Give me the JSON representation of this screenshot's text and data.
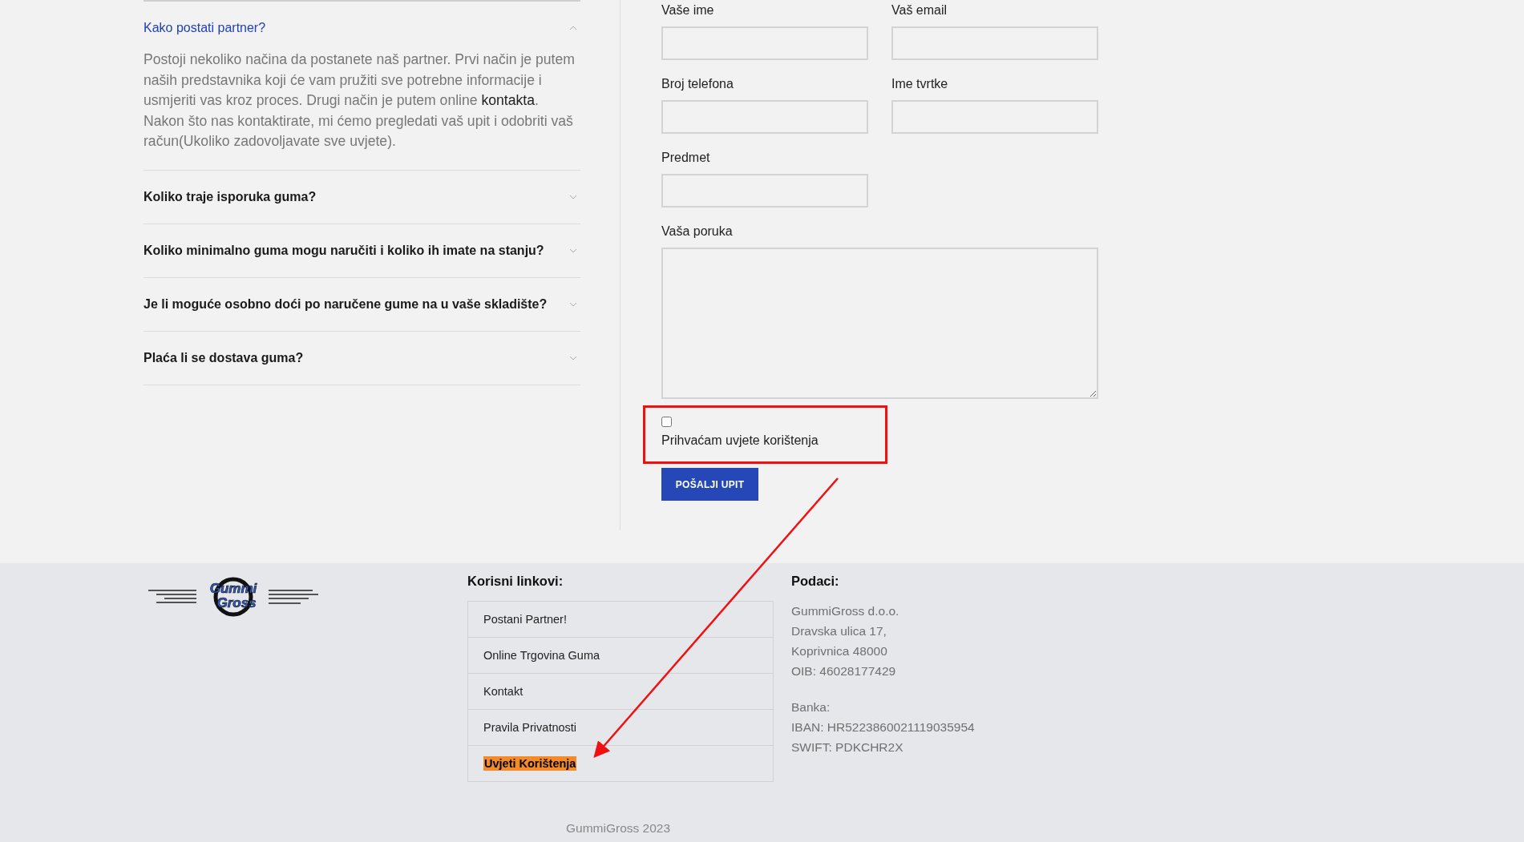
{
  "faq": [
    {
      "question": "Kako postati partner?",
      "expanded": true,
      "answer": {
        "before": "Postoji nekoliko načina da postanete naš partner. Prvi način je putem naših predstavnika koji će vam pružiti sve potrebne informacije i usmjeriti vas kroz proces. Drugi način je putem online ",
        "link": "kontakta",
        "after": ". Nakon što nas kontaktirate, mi ćemo pregledati vaš upit i odobriti vaš račun(Ukoliko zadovoljavate sve uvjete)."
      }
    },
    {
      "question": "Koliko traje isporuka guma?",
      "expanded": false
    },
    {
      "question": "Koliko minimalno guma mogu naručiti i koliko ih imate na stanju?",
      "expanded": false
    },
    {
      "question": "Je li moguće osobno doći po naručene gume na u vaše skladište?",
      "expanded": false
    },
    {
      "question": "Plaća li se dostava guma?",
      "expanded": false
    }
  ],
  "form": {
    "fields": [
      {
        "label": "Vaše ime",
        "kind": "input"
      },
      {
        "label": "Vaš email",
        "kind": "input"
      },
      {
        "label": "Broj telefona",
        "kind": "input"
      },
      {
        "label": "Ime tvrtke",
        "kind": "input"
      },
      {
        "label": "Predmet",
        "kind": "input"
      },
      {
        "label": "Vaša poruka",
        "kind": "textarea"
      }
    ],
    "consent": {
      "label": "Prihvaćam uvjete korištenja",
      "checked": false
    },
    "submit": "POŠALJI UPIT"
  },
  "footer": {
    "logo": {
      "line_1": "Gummi",
      "line_2": "Gross"
    },
    "links_title": "Korisni linkovi:",
    "links": [
      {
        "label": "Postani Partner!",
        "highlighted": false
      },
      {
        "label": "Online Trgovina Guma",
        "highlighted": false
      },
      {
        "label": "Kontakt",
        "highlighted": false
      },
      {
        "label": "Pravila Privatnosti",
        "highlighted": false
      },
      {
        "label": "Uvjeti Korištenja",
        "highlighted": true
      }
    ],
    "info_title": "Podaci:",
    "info_lines": [
      "GummiGross d.o.o.",
      "Dravska ulica 17,",
      "Koprivnica 48000",
      "OIB: 46028177429"
    ],
    "bank_lines": [
      "Banka:",
      "IBAN: HR5223860021119035954",
      "SWIFT: PDKCHR2X"
    ],
    "copyright": "GummiGross 2023"
  }
}
